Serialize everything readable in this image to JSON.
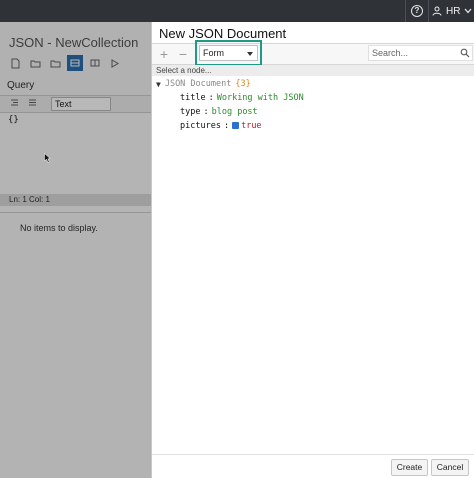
{
  "topbar": {
    "help_glyph": "?",
    "user_label": "HR",
    "icons": [
      "help-icon",
      "user-icon",
      "chevron-down-icon"
    ]
  },
  "background": {
    "title": "JSON - NewCollection",
    "query_label": "Query",
    "query_mode": "Text",
    "editor_text": "{}",
    "status_text": "Ln: 1    Col: 1",
    "results_empty": "No items to display."
  },
  "dialog": {
    "title": "New JSON Document",
    "toolbar": {
      "add_glyph": "+",
      "remove_glyph": "−",
      "mode_value": "Form",
      "search_placeholder": "Search..."
    },
    "select_node_hint": "Select a node...",
    "tree": {
      "root_label": "JSON Document",
      "root_count": "{3}",
      "fields": [
        {
          "key": "title",
          "value": "Working with JSON",
          "type": "string"
        },
        {
          "key": "type",
          "value": "blog post",
          "type": "string"
        },
        {
          "key": "pictures",
          "value": "true",
          "type": "boolean",
          "checked": true
        }
      ]
    },
    "buttons": {
      "create": "Create",
      "cancel": "Cancel"
    }
  },
  "colors": {
    "highlight": "#1f9b85",
    "topbar": "#2f3338",
    "string_value": "#2a8c2a",
    "boolean_value": "#c0182a",
    "active_tool": "#2a6fb0"
  }
}
